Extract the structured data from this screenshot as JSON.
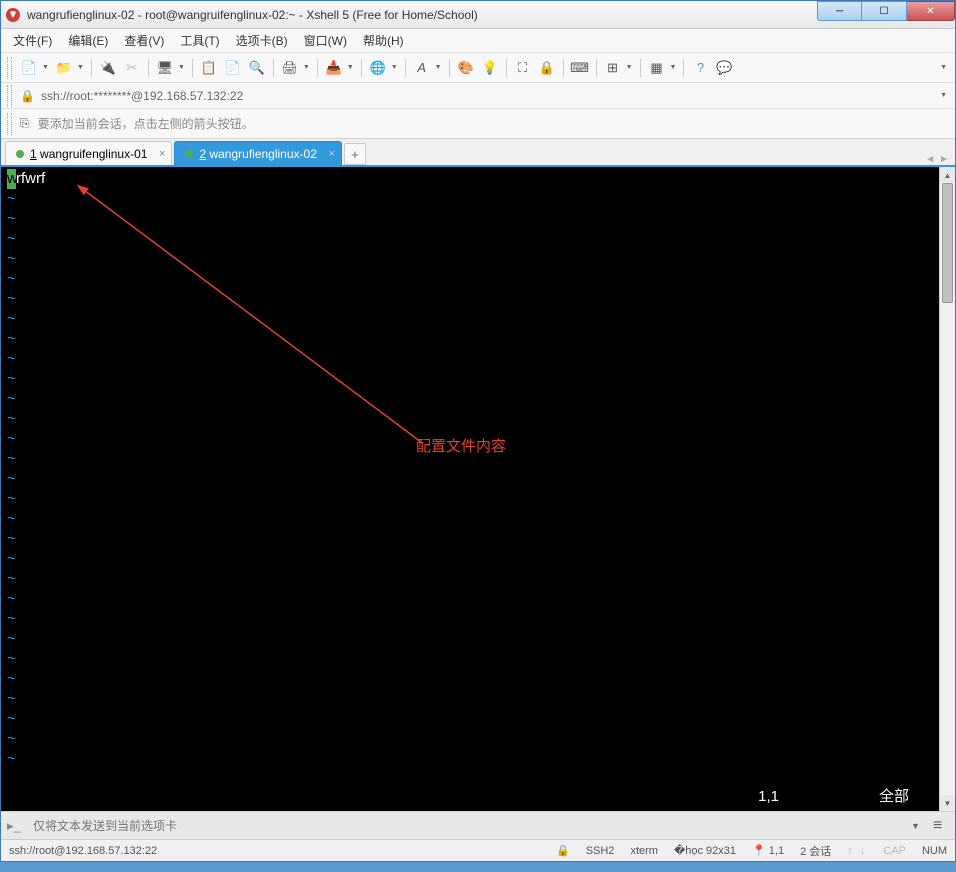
{
  "window": {
    "title": "wangrufienglinux-02 - root@wangruifenglinux-02:~ - Xshell 5 (Free for Home/School)"
  },
  "menu": {
    "file": "文件(F)",
    "edit": "编辑(E)",
    "view": "查看(V)",
    "tools": "工具(T)",
    "tab": "选项卡(B)",
    "window": "窗口(W)",
    "help": "帮助(H)"
  },
  "address": {
    "lock_icon": "🔒",
    "url": "ssh://root:********@192.168.57.132:22"
  },
  "hint": {
    "icon": "⎘",
    "text": "要添加当前会话，点击左侧的箭头按钮。"
  },
  "tabs": [
    {
      "index": "1",
      "label": "wangruifenglinux-01",
      "active": false
    },
    {
      "index": "2",
      "label": "wangrufienglinux-02",
      "active": true
    }
  ],
  "terminal": {
    "first_char": "w",
    "rest": "rfwrf",
    "tilde": "~",
    "tilde_count": 29,
    "status_pos": "1,1",
    "status_all": "全部"
  },
  "annotation": "配置文件内容",
  "inputbar": {
    "placeholder": "仅将文本发送到当前选项卡"
  },
  "status": {
    "left": "ssh://root@192.168.57.132:22",
    "ssh": "SSH2",
    "term": "xterm",
    "size": "92x31",
    "pos": "1,1",
    "sessions": "2 会话",
    "cap": "CAP",
    "num": "NUM"
  }
}
